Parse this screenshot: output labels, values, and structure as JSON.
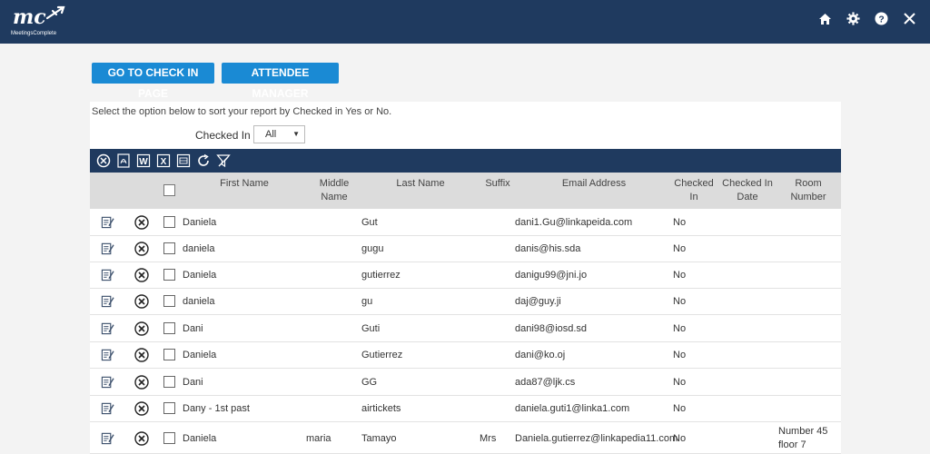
{
  "header": {
    "logo_text": "mc",
    "logo_sub": "MeetingsComplete"
  },
  "actions": {
    "checkin_label": "GO TO CHECK IN PAGE",
    "attendee_label": "ATTENDEE MANAGER"
  },
  "report": {
    "instruction": "Select the option below to sort your report by Checked in Yes or No.",
    "filter_label": "Checked In",
    "filter_value": "All"
  },
  "table": {
    "columns": {
      "first": "First Name",
      "middle": "Middle Name",
      "last": "Last Name",
      "suffix": "Suffix",
      "email": "Email Address",
      "checked": "Checked In",
      "checked_date": "Checked In Date",
      "room": "Room Number"
    },
    "rows": [
      {
        "first": "Daniela",
        "middle": "",
        "last": "Gut",
        "suffix": "",
        "email": "dani1.Gu@linkapeida.com",
        "checked": "No",
        "room": ""
      },
      {
        "first": "daniela",
        "middle": "",
        "last": "gugu",
        "suffix": "",
        "email": "danis@his.sda",
        "checked": "No",
        "room": ""
      },
      {
        "first": "Daniela",
        "middle": "",
        "last": "gutierrez",
        "suffix": "",
        "email": "danigu99@jni.jo",
        "checked": "No",
        "room": ""
      },
      {
        "first": "daniela",
        "middle": "",
        "last": "gu",
        "suffix": "",
        "email": "daj@guy.ji",
        "checked": "No",
        "room": ""
      },
      {
        "first": "Dani",
        "middle": "",
        "last": "Guti",
        "suffix": "",
        "email": "dani98@iosd.sd",
        "checked": "No",
        "room": ""
      },
      {
        "first": "Daniela",
        "middle": "",
        "last": "Gutierrez",
        "suffix": "",
        "email": "dani@ko.oj",
        "checked": "No",
        "room": ""
      },
      {
        "first": "Dani",
        "middle": "",
        "last": "GG",
        "suffix": "",
        "email": "ada87@ljk.cs",
        "checked": "No",
        "room": ""
      },
      {
        "first": "Dany - 1st past",
        "middle": "",
        "last": "airtickets",
        "suffix": "",
        "email": "daniela.guti1@linka1.com",
        "checked": "No",
        "room": ""
      },
      {
        "first": "Daniela",
        "middle": "maria",
        "last": "Tamayo",
        "suffix": "Mrs",
        "email": "Daniela.gutierrez@linkapedia11.com",
        "checked": "No",
        "room": "Number 45 floor 7"
      }
    ]
  },
  "colors": {
    "header_bg": "#1f3a5f",
    "button_bg": "#1a8ad4",
    "table_header_bg": "#dcdcdc"
  },
  "icons": {
    "top": [
      "home-icon",
      "gear-icon",
      "help-icon",
      "close-icon"
    ],
    "toolbar": [
      "clear-icon",
      "pdf-icon",
      "word-icon",
      "excel-icon",
      "csv-icon",
      "refresh-icon",
      "filter-clear-icon"
    ],
    "row": [
      "edit-icon",
      "delete-icon"
    ]
  }
}
